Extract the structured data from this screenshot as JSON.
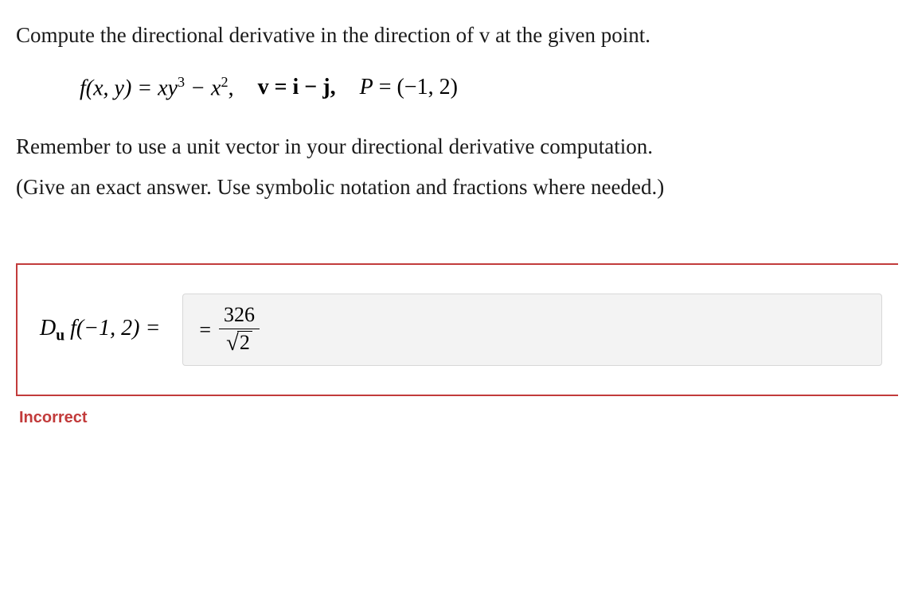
{
  "question": {
    "prompt": "Compute the directional derivative in the direction of v at the given point.",
    "function_label": "f(x, y) = xy",
    "f_exp1": "3",
    "minus": " − x",
    "f_exp2": "2",
    "comma": ",",
    "v_label": "v = i − j,",
    "p_label": "P = (−1, 2)",
    "hint_line1": "Remember to use a unit vector in your directional derivative computation.",
    "hint_line2": "(Give an exact answer. Use symbolic notation and fractions where needed.)"
  },
  "answer": {
    "label_prefix": "D",
    "label_sub": "u",
    "label_rest": " f(−1, 2) =",
    "equals": "=",
    "numerator": "326",
    "radicand": "2"
  },
  "feedback": {
    "text": "Incorrect"
  }
}
